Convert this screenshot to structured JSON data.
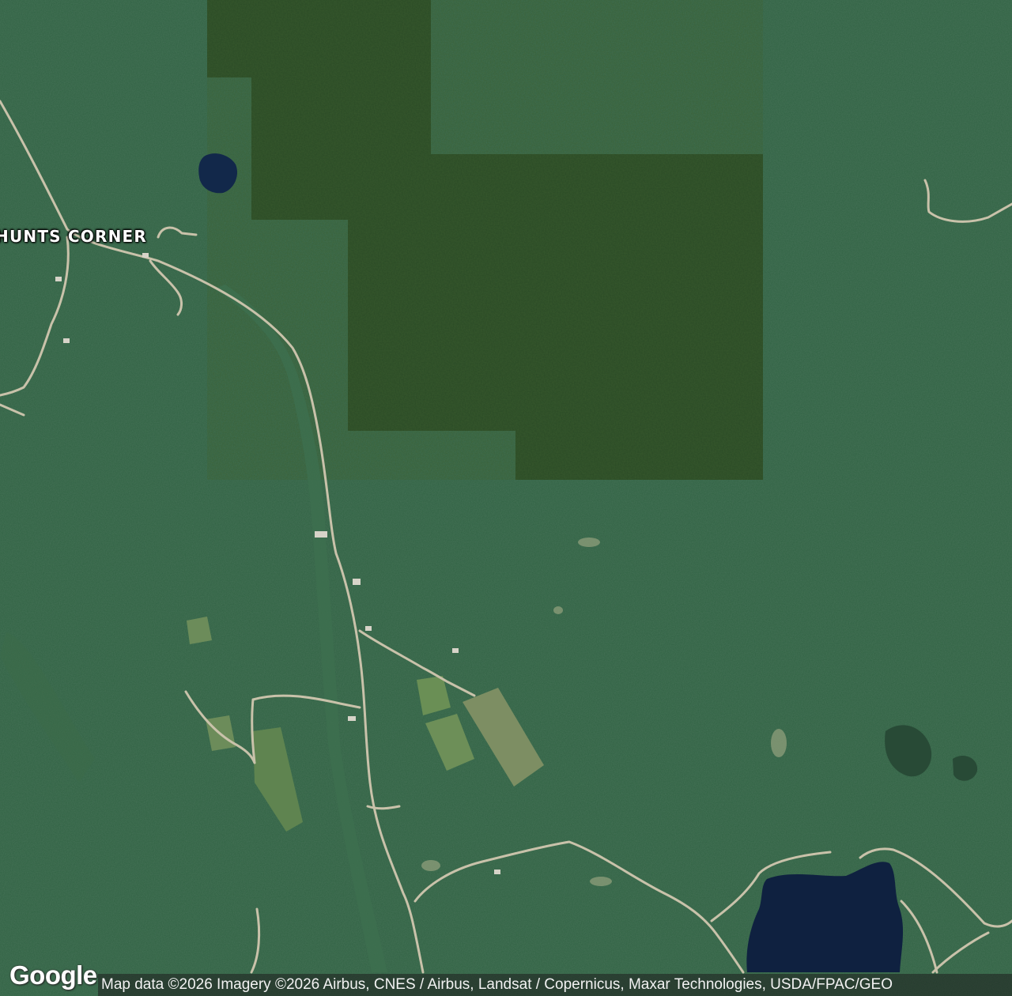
{
  "map": {
    "type": "satellite",
    "place_labels": [
      {
        "id": "hunts-corner",
        "text": "HUNTS CORNER"
      }
    ],
    "logo": "Google",
    "attribution": "Map data ©2026 Imagery ©2026 Airbus, CNES / Airbus, Landsat / Copernicus, Maxar Technologies, USDA/FPAC/GEO"
  }
}
